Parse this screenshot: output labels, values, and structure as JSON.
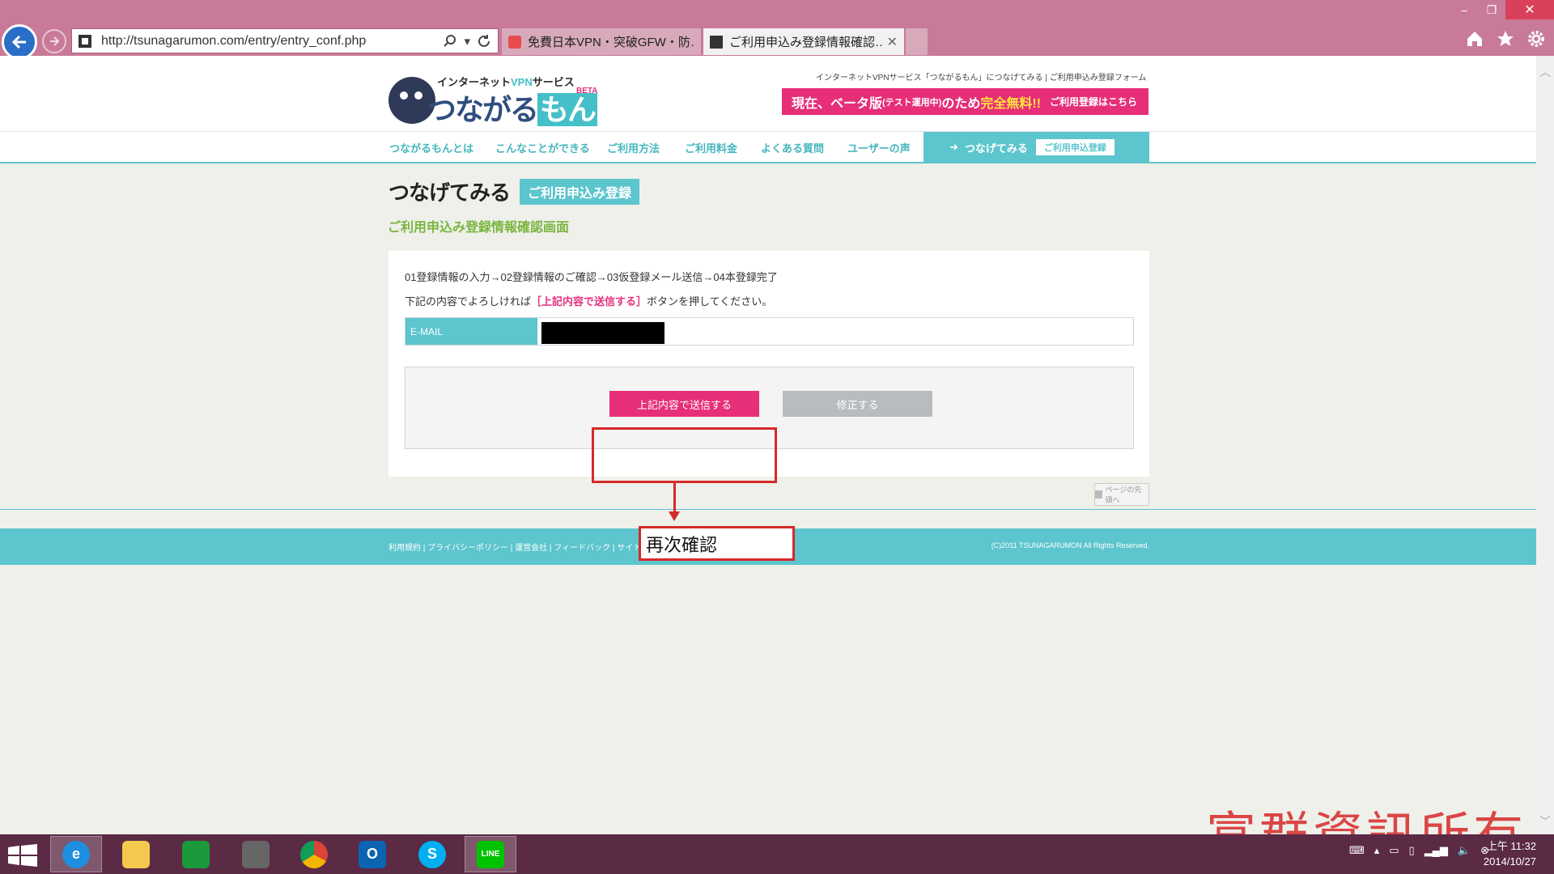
{
  "browser": {
    "url": "http://tsunagarumon.com/entry/entry_conf.php",
    "tabs": [
      {
        "title": "免費日本VPN・突破GFW・防…"
      },
      {
        "title": "ご利用申込み登録情報確認…"
      }
    ],
    "window_controls": {
      "minimize": "–",
      "restore": "❐",
      "close": "✕"
    }
  },
  "site": {
    "logo_kicker_prefix": "インターネット",
    "logo_kicker_vpn": "VPN",
    "logo_kicker_suffix": "サービス",
    "logo_name": "つながる",
    "logo_name_mon": "もん",
    "logo_beta": "BETA",
    "top_links": "インターネットVPNサービス「つながるもん」につなげてみる | ご利用申込み登録フォーム",
    "banner": {
      "lead": "現在、ベータ版",
      "small": "(テスト運用中)",
      "mid": "のため",
      "free": "完全無料!!",
      "cta": "ご利用登録はこちら"
    },
    "nav": [
      "つながるもんとは",
      "こんなことができる",
      "ご利用方法",
      "ご利用料金",
      "よくある質問",
      "ユーザーの声"
    ],
    "nav_active": {
      "label": "つなげてみる",
      "pill": "ご利用申込登録"
    }
  },
  "main": {
    "title": "つなげてみる",
    "title_tag": "ご利用申込み登録",
    "subtitle": "ご利用申込み登録情報確認画面",
    "steps": "01登録情報の入力→02登録情報のご確認→03仮登録メール送信→04本登録完了",
    "note_before": "下記の内容でよろしければ",
    "note_highlight": "［上記内容で送信する］",
    "note_after": "ボタンを押してください。",
    "email_label": "E-MAIL",
    "send_button": "上記内容で送信する",
    "edit_button": "修正する",
    "pagetop": "ページの先頭へ"
  },
  "annotation": {
    "label": "再次確認"
  },
  "footer": {
    "links": "利用規約 | プライバシーポリシー | 運営会社 | フィードバック | サイトマップ |",
    "copyright": "(C)2011 TSUNAGARUMON All Rights Reserved."
  },
  "watermark": "富群資訊所有",
  "taskbar": {
    "time": "上午 11:32",
    "date": "2014/10/27"
  },
  "colors": {
    "chrome": "#c87a98",
    "teal": "#5cc5cd",
    "pink": "#e62e79",
    "green_sub": "#7ab540",
    "annotation_red": "#d42a2a"
  }
}
